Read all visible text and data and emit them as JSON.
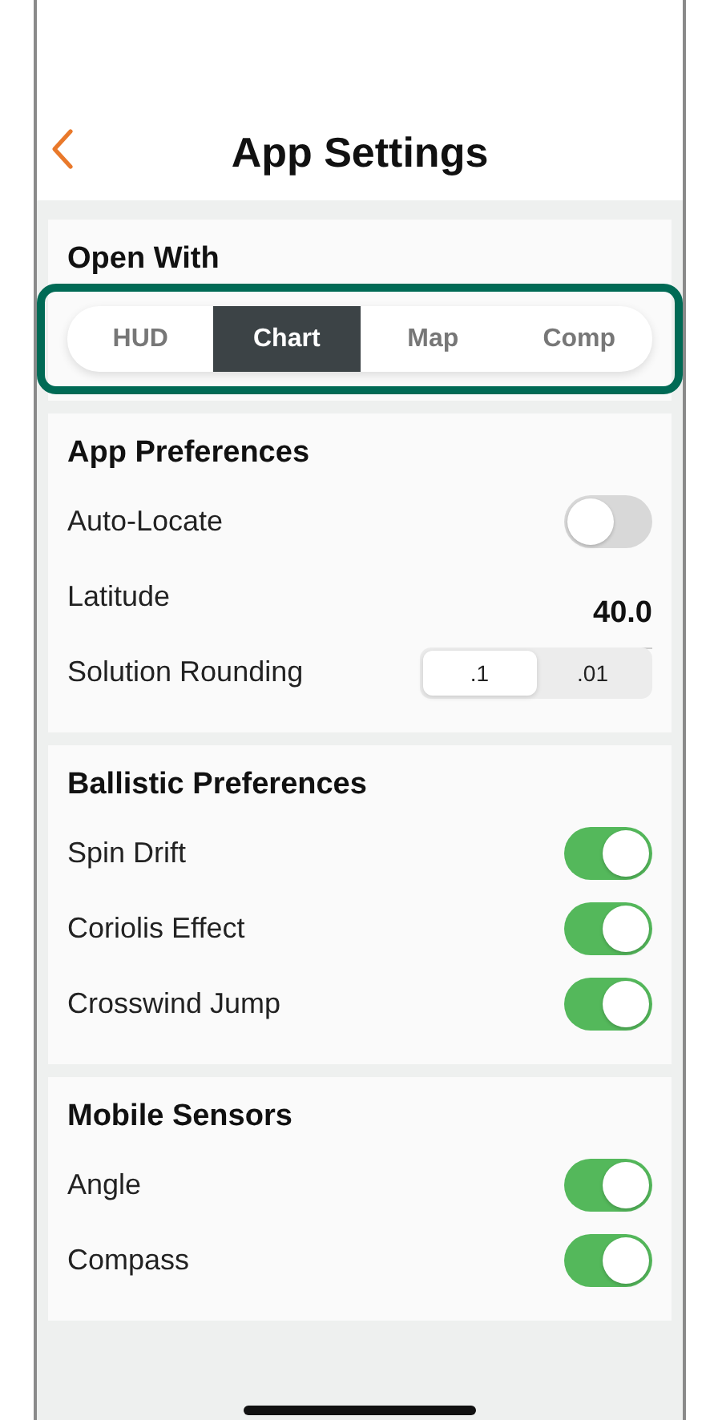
{
  "header": {
    "title": "App Settings"
  },
  "sections": [
    {
      "title": "Open With",
      "kind": "segments",
      "highlighted": true,
      "options": [
        {
          "label": "HUD",
          "selected": false
        },
        {
          "label": "Chart",
          "selected": true
        },
        {
          "label": "Map",
          "selected": false
        },
        {
          "label": "Comp",
          "selected": false
        }
      ]
    },
    {
      "title": "App Preferences",
      "kind": "rows",
      "rows": [
        {
          "kind": "toggle",
          "label": "Auto-Locate",
          "on": false
        },
        {
          "kind": "value",
          "label": "Latitude",
          "value": "40.0"
        },
        {
          "kind": "choice",
          "label": "Solution Rounding",
          "options": [
            {
              "label": ".1",
              "selected": true
            },
            {
              "label": ".01",
              "selected": false
            }
          ]
        }
      ]
    },
    {
      "title": "Ballistic Preferences",
      "kind": "rows",
      "rows": [
        {
          "kind": "toggle",
          "label": "Spin Drift",
          "on": true
        },
        {
          "kind": "toggle",
          "label": "Coriolis Effect",
          "on": true
        },
        {
          "kind": "toggle",
          "label": "Crosswind Jump",
          "on": true
        }
      ]
    },
    {
      "title": "Mobile Sensors",
      "kind": "rows",
      "rows": [
        {
          "kind": "toggle",
          "label": "Angle",
          "on": true
        },
        {
          "kind": "toggle",
          "label": "Compass",
          "on": true
        }
      ]
    }
  ]
}
